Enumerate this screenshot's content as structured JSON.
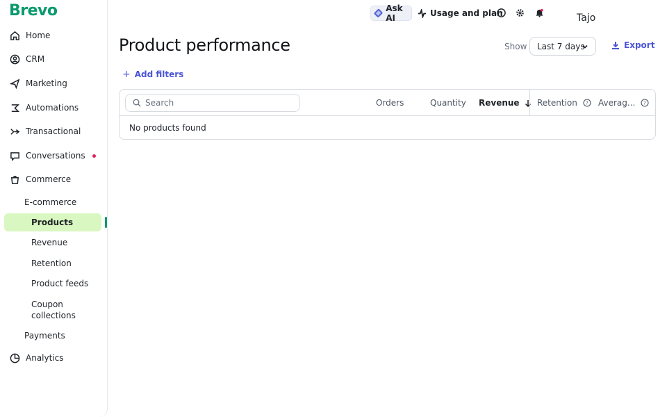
{
  "brand": {
    "name": "Brevo",
    "color": "#0b996e"
  },
  "sidebar": {
    "items": [
      {
        "label": "Home",
        "icon": "home-icon"
      },
      {
        "label": "CRM",
        "icon": "contacts-icon"
      },
      {
        "label": "Marketing",
        "icon": "send-icon"
      },
      {
        "label": "Automations",
        "icon": "automation-icon"
      },
      {
        "label": "Transactional",
        "icon": "transactional-icon"
      },
      {
        "label": "Conversations",
        "icon": "chat-icon",
        "notification": true
      },
      {
        "label": "Commerce",
        "icon": "commerce-icon"
      }
    ],
    "commerce_sub": {
      "group": "E-commerce",
      "items": [
        "Products",
        "Revenue",
        "Retention",
        "Product feeds",
        "Coupon collections"
      ],
      "active": "Products"
    },
    "payments": "Payments",
    "analytics": {
      "label": "Analytics",
      "icon": "analytics-icon"
    }
  },
  "topbar": {
    "ask_ai": "Ask AI",
    "usage": "Usage and plan",
    "icons": [
      "help-icon",
      "settings-icon",
      "notification-bell-icon"
    ],
    "user": "Tajo"
  },
  "header": {
    "title": "Product performance",
    "show_label": "Show",
    "date_range": "Last 7 days",
    "export_label": "Export",
    "add_filters": "Add filters"
  },
  "table": {
    "search_placeholder": "Search",
    "columns": [
      "Orders",
      "Quantity",
      "Revenue",
      "Retention",
      "Averag..."
    ],
    "sorted_column": "Revenue",
    "empty_message": "No products found"
  },
  "colors": {
    "accent": "#4b55d6",
    "active_bg": "#d9f7c0",
    "notification": "#e0245e"
  }
}
